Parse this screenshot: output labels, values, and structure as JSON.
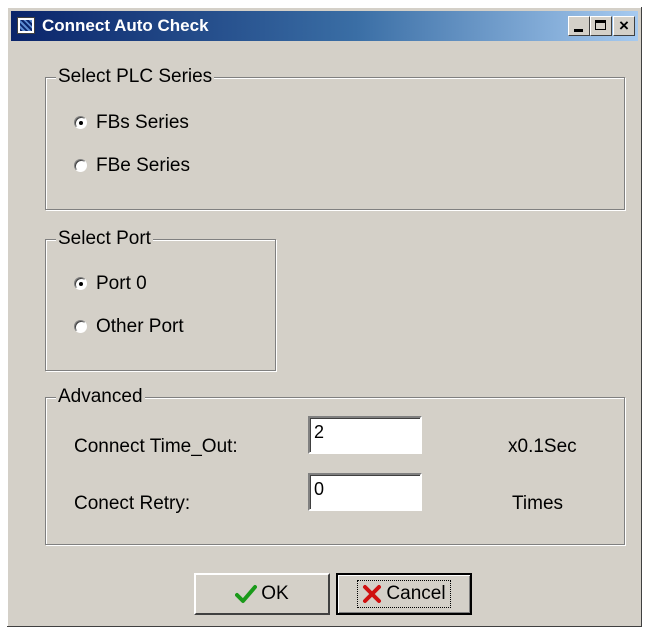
{
  "window": {
    "title": "Connect Auto Check",
    "minimize_glyph": "_",
    "close_glyph": "×"
  },
  "plc_series": {
    "legend": "Select PLC Series",
    "options": [
      {
        "label": "FBs Series",
        "selected": true
      },
      {
        "label": "FBe Series",
        "selected": false
      }
    ]
  },
  "port": {
    "legend": "Select Port",
    "options": [
      {
        "label": "Port 0",
        "selected": true
      },
      {
        "label": "Other Port",
        "selected": false
      }
    ]
  },
  "advanced": {
    "legend": "Advanced",
    "timeout_label": "Connect Time_Out:",
    "timeout_value": "2",
    "timeout_unit": "x0.1Sec",
    "retry_label": "Conect Retry:",
    "retry_value": "0",
    "retry_unit": "Times"
  },
  "buttons": {
    "ok_label": "OK",
    "cancel_label": "Cancel"
  },
  "icons": {
    "ok": "check-icon",
    "cancel": "x-icon",
    "app": "app-icon"
  },
  "colors": {
    "titlebar_start": "#0a246a",
    "titlebar_end": "#a6caf0",
    "dialog_bg": "#d4d0c8",
    "ok_check": "#1a9a1a",
    "cancel_x": "#d01010"
  }
}
